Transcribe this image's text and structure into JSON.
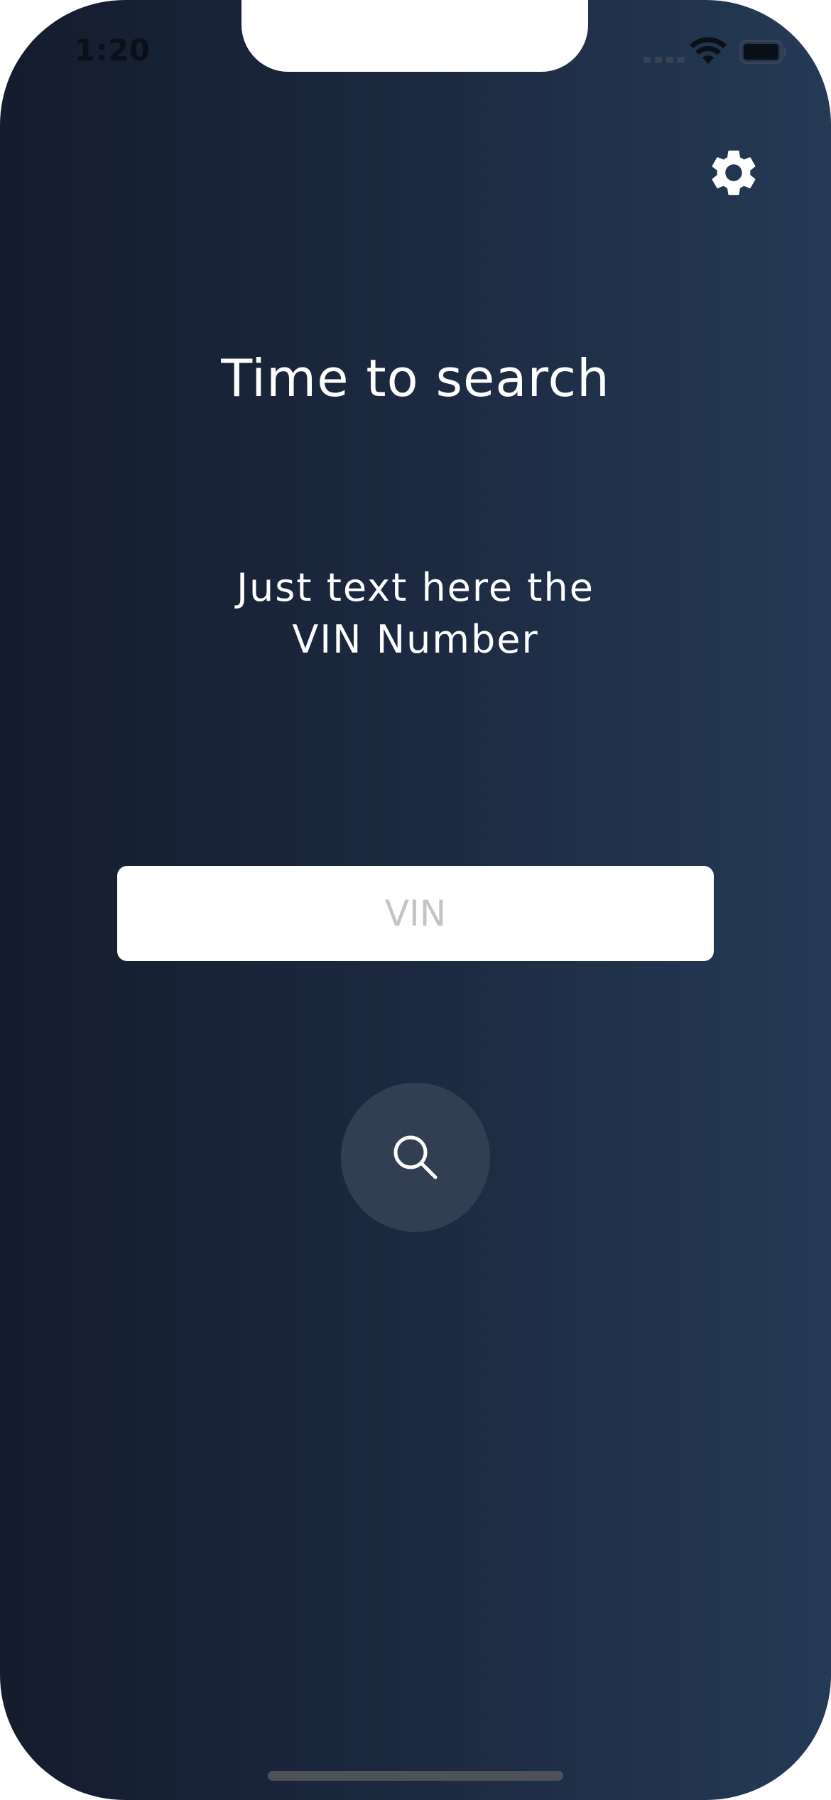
{
  "status_bar": {
    "time": "1:20",
    "icons": [
      "cellular-signal-icon",
      "wifi-icon",
      "battery-icon"
    ]
  },
  "header": {
    "settings_icon": "gear-icon"
  },
  "main": {
    "title": "Time to search",
    "subtitle_line1": "Just text here the",
    "subtitle_line2": "VIN Number",
    "vin_input": {
      "placeholder": "VIN",
      "value": ""
    },
    "search_button_icon": "search-icon"
  },
  "colors": {
    "background_start": "#141c2d",
    "background_end": "#253a55",
    "search_button": "#323f52",
    "text": "#ffffff",
    "placeholder": "#c4c4c4"
  }
}
